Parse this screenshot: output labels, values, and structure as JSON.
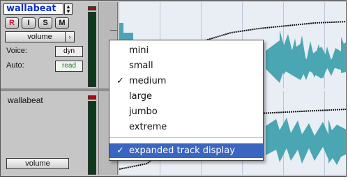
{
  "track1": {
    "name": "wallabeat",
    "stepper_icon": "up-down-arrows",
    "buttons": {
      "record": "R",
      "input": "I",
      "solo": "S",
      "mute": "M"
    },
    "view_selector": "volume",
    "view_arrow": "›",
    "voice_label": "Voice:",
    "voice_value": "dyn",
    "auto_label": "Auto:",
    "auto_value": "read"
  },
  "track2": {
    "name": "wallabeat",
    "view_selector": "volume"
  },
  "menu": {
    "items": [
      {
        "label": "mini",
        "checked": false
      },
      {
        "label": "small",
        "checked": false
      },
      {
        "label": "medium",
        "checked": true
      },
      {
        "label": "large",
        "checked": false
      },
      {
        "label": "jumbo",
        "checked": false
      },
      {
        "label": "extreme",
        "checked": false
      }
    ],
    "expanded": {
      "label": "expanded track display",
      "checked": true
    },
    "checkmark": "✓"
  },
  "colors": {
    "track_name": "#0a2fd0",
    "record": "#c8102e",
    "waveform": "#4aa6b2",
    "meter": "#0c3a1a",
    "clip": "#9b1111",
    "menu_highlight": "#3a66c2",
    "read": "#1a7a2a"
  }
}
